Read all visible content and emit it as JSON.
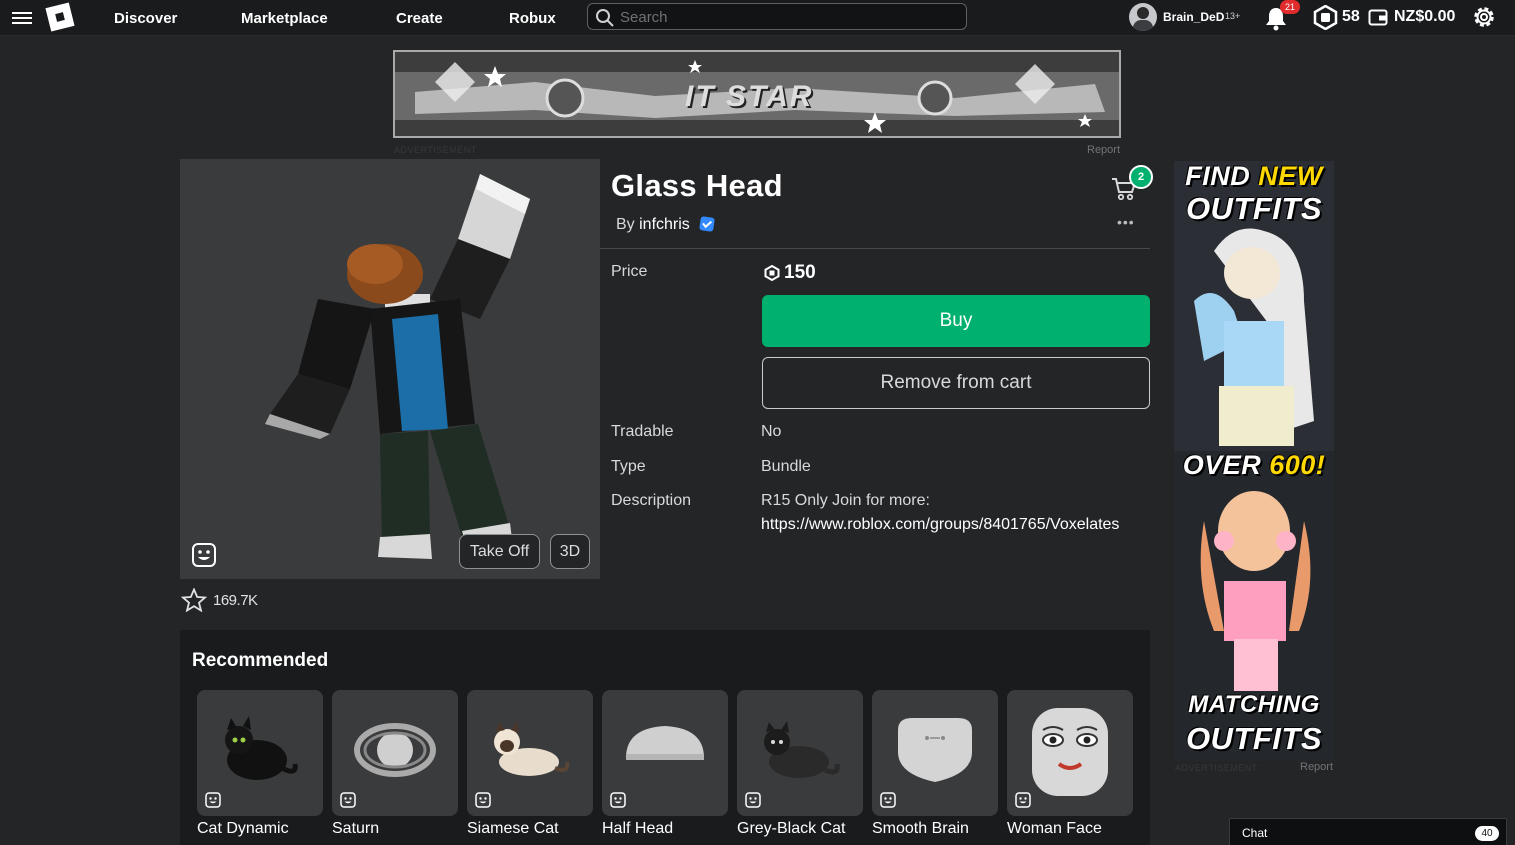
{
  "nav": {
    "discover": "Discover",
    "marketplace": "Marketplace",
    "create": "Create",
    "robux": "Robux"
  },
  "search": {
    "placeholder": "Search"
  },
  "user": {
    "name": "Brain_DeD",
    "age": "13+"
  },
  "notifications": {
    "count": "21"
  },
  "balance": {
    "robux": "58",
    "wallet": "NZ$0.00"
  },
  "banner_ad": {
    "text": "IT STAR",
    "label": "ADVERTISEMENT",
    "report": "Report"
  },
  "item": {
    "title": "Glass Head",
    "by_prefix": "By",
    "creator": "infchris",
    "price_label": "Price",
    "price": "150",
    "buy_label": "Buy",
    "remove_label": "Remove from cart",
    "tradable_label": "Tradable",
    "tradable": "No",
    "type_label": "Type",
    "type": "Bundle",
    "description_label": "Description",
    "description": "R15 Only Join for more:",
    "description_link": "https://www.roblox.com/groups/8401765/Voxelates",
    "favorites": "169.7K",
    "cart_count": "2",
    "more": "•••"
  },
  "preview": {
    "take_off": "Take Off",
    "view_3d": "3D"
  },
  "recommended": {
    "title": "Recommended",
    "items": [
      {
        "name": "Cat Dynamic"
      },
      {
        "name": "Saturn"
      },
      {
        "name": "Siamese Cat"
      },
      {
        "name": "Half Head"
      },
      {
        "name": "Grey-Black Cat"
      },
      {
        "name": "Smooth Brain"
      },
      {
        "name": "Woman Face"
      }
    ]
  },
  "side_ad": {
    "line1a": "FIND",
    "line1b": "NEW",
    "line2": "OUTFITS",
    "line3a": "OVER",
    "line3b": "600!",
    "line4": "MATCHING",
    "line5": "OUTFITS",
    "label": "ADVERTISEMENT",
    "report": "Report"
  },
  "chat": {
    "label": "Chat",
    "count": "40"
  },
  "colors": {
    "buy": "#00b06f",
    "background": "#232527",
    "topbar": "#191b1d",
    "badge": "#e02c2c"
  }
}
